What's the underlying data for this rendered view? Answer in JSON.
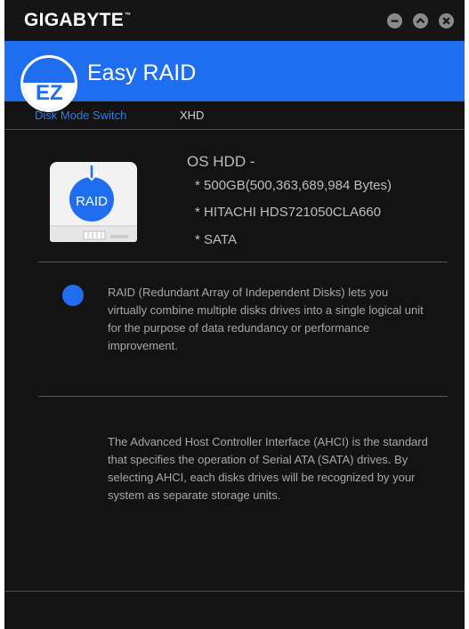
{
  "window": {
    "brand": "GIGABYTE",
    "brand_mark": "™",
    "controls": {
      "minimize_icon": "minus-circle-icon",
      "collapse_icon": "chevron-up-circle-icon",
      "close_icon": "x-circle-icon"
    }
  },
  "header": {
    "logo_text": "EZ",
    "title": "Easy RAID"
  },
  "tabs": [
    {
      "label": "Disk Mode Switch",
      "active": true
    },
    {
      "label": "XHD",
      "active": false
    }
  ],
  "disk": {
    "icon_label": "RAID",
    "title": "OS HDD -",
    "details": [
      "* 500GB(500,363,689,984 Bytes)",
      "* HITACHI HDS721050CLA660",
      "* SATA"
    ]
  },
  "options": [
    {
      "selected": true,
      "text": "RAID (Redundant Array of Independent Disks) lets you virtually combine multiple disks drives into a single logical unit for the purpose of data redundancy or performance improvement."
    },
    {
      "selected": false,
      "text": "The Advanced Host Controller Interface (AHCI) is the standard that specifies the operation of Serial ATA (SATA) drives. By selecting AHCI, each disks drives will be recognized by your system as separate storage units."
    }
  ],
  "colors": {
    "accent": "#1e6eef",
    "background": "#131313",
    "text": "#bdbdbd"
  }
}
